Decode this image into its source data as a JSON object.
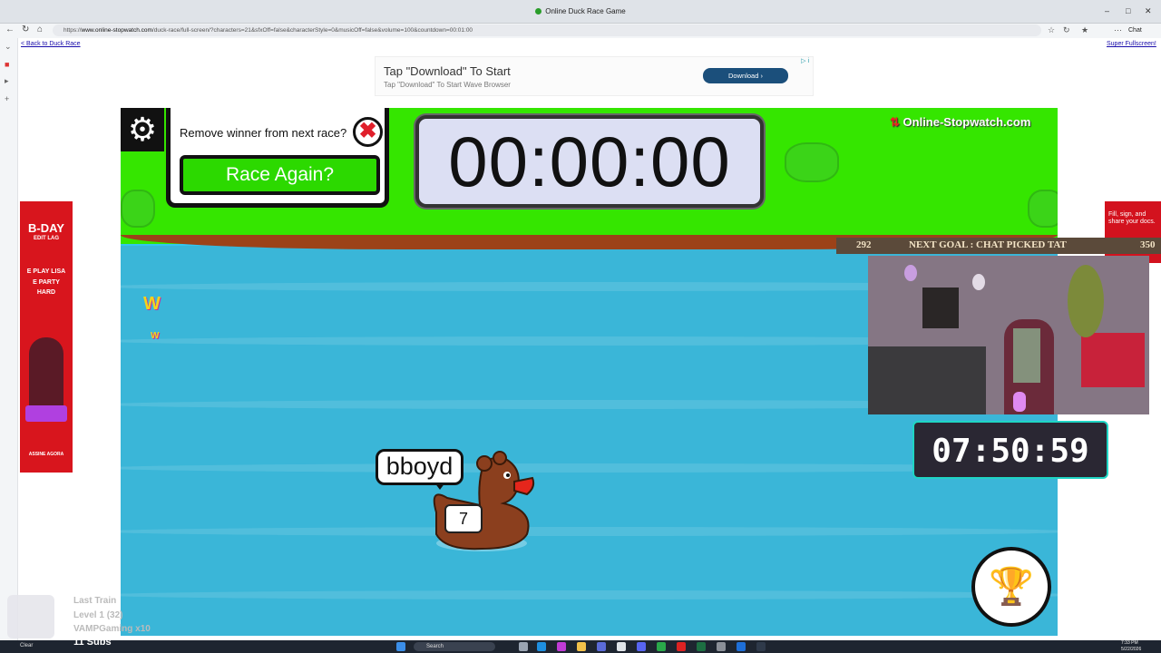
{
  "browser": {
    "window_title": "Online Duck Race Game",
    "url_prefix": "https://",
    "url_host": "www.online-stopwatch.com",
    "url_rest": "/duck-race/full-screen/?characters=21&sfxOff=false&characterStyle=0&musicOff=false&volume=100&countdown=00:01:00",
    "chat_label": "Chat"
  },
  "page": {
    "back_link": "< Back to Duck Race",
    "fullscreen_link": "Super Fullscreen!"
  },
  "ad_top": {
    "headline": "Tap \"Download\" To Start",
    "subline": "Tap \"Download\" To Start Wave Browser",
    "button": "Download",
    "marker": "▷ i"
  },
  "game": {
    "remove_winner_label": "Remove winner from next race?",
    "race_again_label": "Race Again?",
    "timer": "00:00:00",
    "brand": "Online-Stopwatch.com",
    "player_name": "bboyd",
    "duck_number": "7",
    "colors": {
      "grass": "#35e600",
      "water": "#3ab6d8",
      "dirt": "#9c4218",
      "duck": "#8b3f1e",
      "button_green": "#2cd900"
    }
  },
  "side_ad_left": {
    "title": "B-DAY",
    "subtitle": "EDIT LAG",
    "lines": [
      "E PLAY LISA",
      "E PARTY",
      "HARD"
    ],
    "footer": "ASSINE AGORA"
  },
  "side_ad_right": {
    "text": "Fill, sign, and share your docs."
  },
  "stream_overlay": {
    "goal_current": "292",
    "goal_text": "NEXT GOAL : CHAT PICKED TAT",
    "goal_target": "350",
    "countdown": "07:50:59",
    "last_train": "Last Train",
    "level": "Level 1  (32)",
    "gifter": "VAMPGaming x10",
    "subs": "11 Subs"
  },
  "taskbar": {
    "search_placeholder": "Search",
    "time": "7:33 PM",
    "date": "5/22/2026",
    "weather": "Clear"
  }
}
